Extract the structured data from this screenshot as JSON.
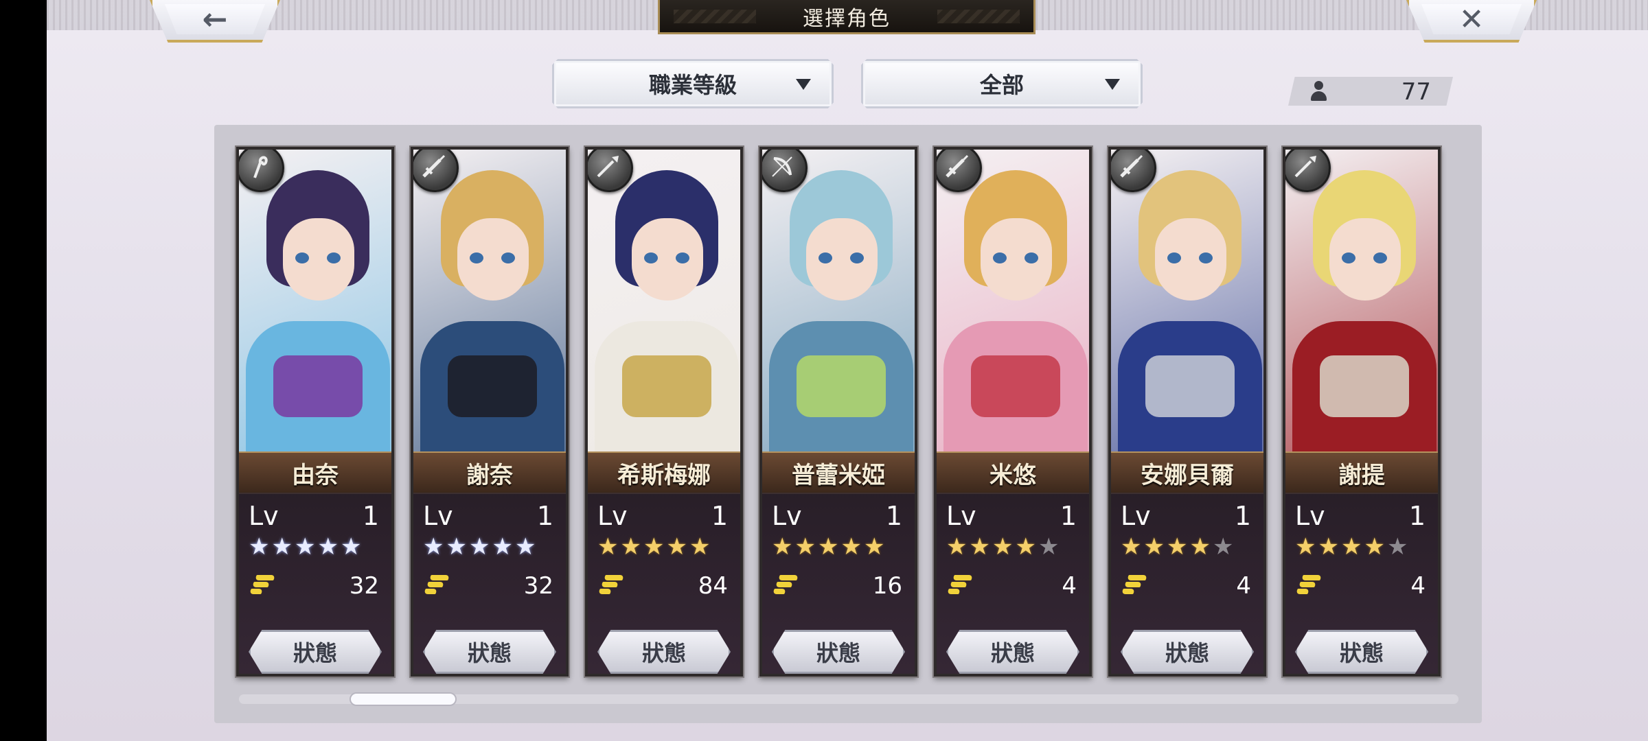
{
  "header": {
    "title": "選擇角色",
    "back_icon": "arrow-left-icon",
    "close_icon": "close-icon"
  },
  "filters": {
    "job_dropdown": "職業等級",
    "category_dropdown": "全部"
  },
  "roster": {
    "count": "77"
  },
  "cards": [
    {
      "name": "由奈",
      "level_label": "Lv",
      "level": "1",
      "stars": 5,
      "star_color": "silver",
      "power": "32",
      "status_label": "狀態",
      "weapon": "staff-icon",
      "palette": {
        "hair": "#3a2d5c",
        "body": "#69b6e0",
        "accent": "#7a3aa0"
      }
    },
    {
      "name": "謝奈",
      "level_label": "Lv",
      "level": "1",
      "stars": 5,
      "star_color": "silver",
      "power": "32",
      "status_label": "狀態",
      "weapon": "sword-icon",
      "palette": {
        "hair": "#d9b061",
        "body": "#2c4d7a",
        "accent": "#1c1c24"
      }
    },
    {
      "name": "希斯梅娜",
      "level_label": "Lv",
      "level": "1",
      "stars": 5,
      "star_color": "gold",
      "power": "84",
      "status_label": "狀態",
      "weapon": "spear-icon",
      "palette": {
        "hair": "#2b2f6a",
        "body": "#ece8e0",
        "accent": "#c8a74a"
      }
    },
    {
      "name": "普蕾米婭",
      "level_label": "Lv",
      "level": "1",
      "stars": 5,
      "star_color": "gold",
      "power": "16",
      "status_label": "狀態",
      "weapon": "bow-icon",
      "palette": {
        "hair": "#9cc8d8",
        "body": "#5d8fb0",
        "accent": "#b4d86a"
      }
    },
    {
      "name": "米悠",
      "level_label": "Lv",
      "level": "1",
      "stars": 4,
      "star_color": "gold",
      "power": "4",
      "status_label": "狀態",
      "weapon": "sword-icon",
      "palette": {
        "hair": "#e0b05a",
        "body": "#e59ab4",
        "accent": "#c43a4a"
      }
    },
    {
      "name": "安娜貝爾",
      "level_label": "Lv",
      "level": "1",
      "stars": 4,
      "star_color": "gold",
      "power": "4",
      "status_label": "狀態",
      "weapon": "sword-icon",
      "palette": {
        "hair": "#e2c37c",
        "body": "#2a3d8a",
        "accent": "#c9ccd6"
      }
    },
    {
      "name": "謝提",
      "level_label": "Lv",
      "level": "1",
      "stars": 4,
      "star_color": "gold",
      "power": "4",
      "status_label": "狀態",
      "weapon": "spear-icon",
      "palette": {
        "hair": "#e9d675",
        "body": "#9b1d24",
        "accent": "#d9d6c8"
      }
    }
  ],
  "scroll": {
    "position": 0.06
  }
}
